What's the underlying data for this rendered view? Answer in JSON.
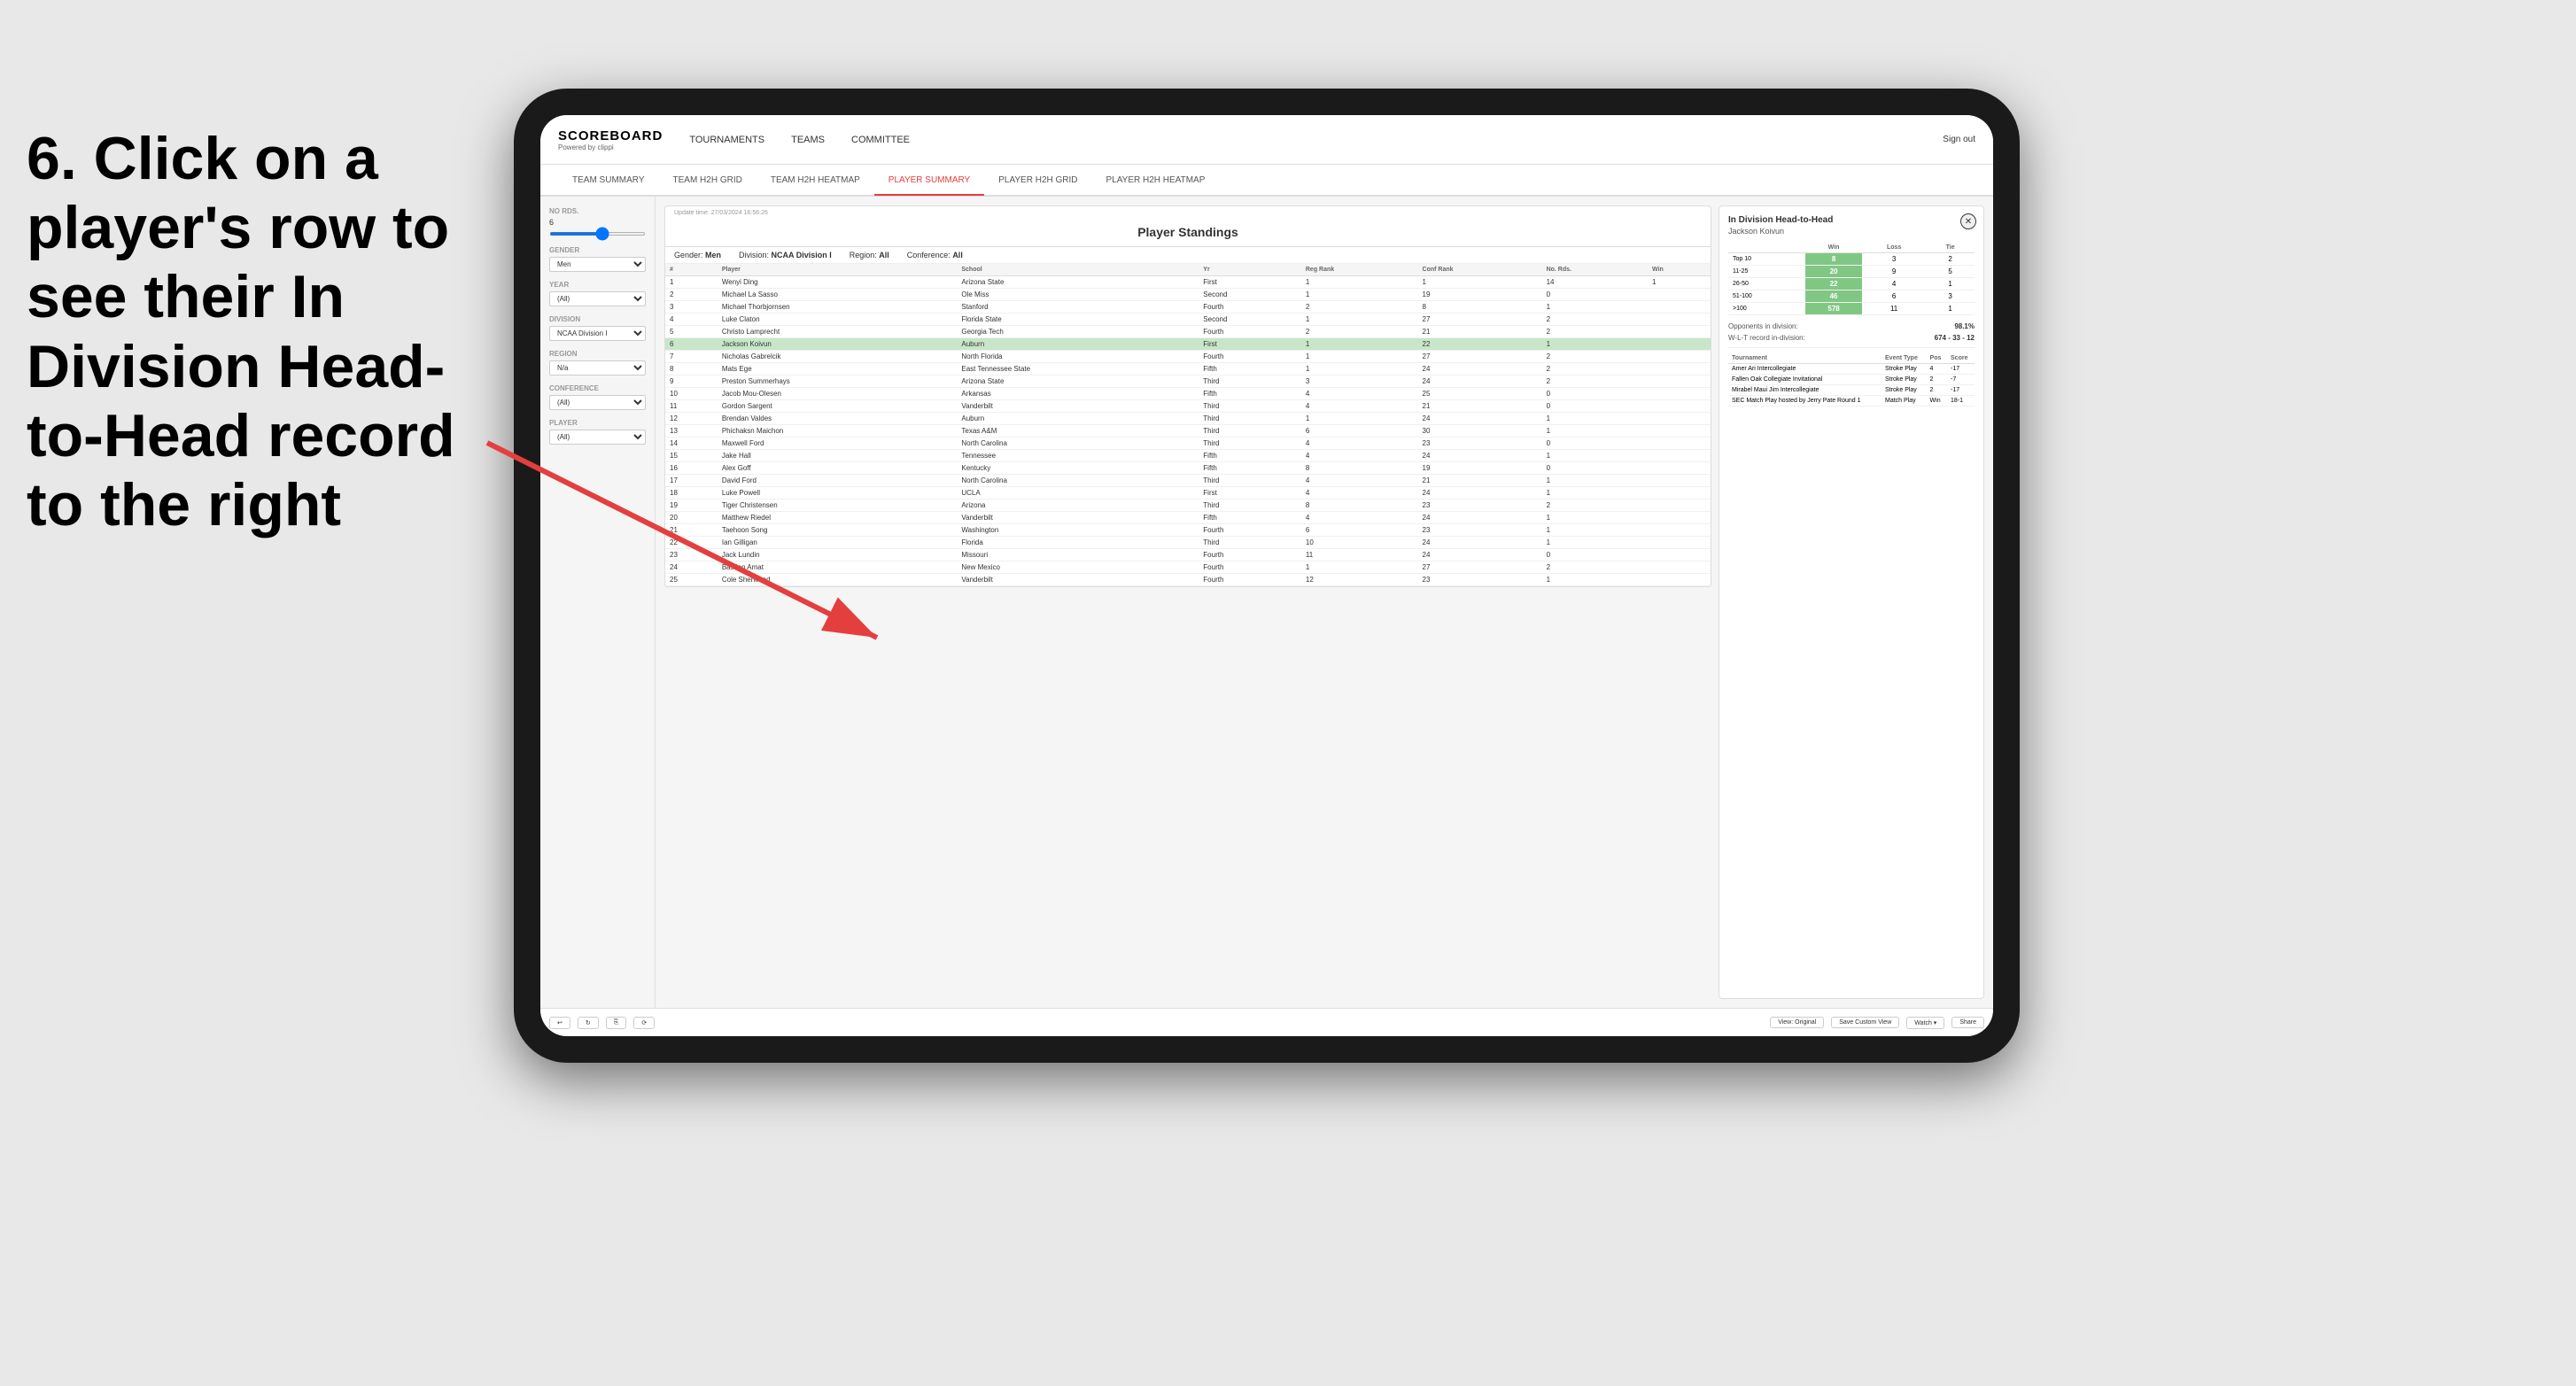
{
  "instruction": {
    "text": "6. Click on a player's row to see their In Division Head-to-Head record to the right"
  },
  "nav": {
    "logo": "SCOREBOARD",
    "logo_sub": "Powered by clippi",
    "links": [
      "TOURNAMENTS",
      "TEAMS",
      "COMMITTEE"
    ],
    "sign_out": "Sign out"
  },
  "sub_nav": {
    "items": [
      "TEAM SUMMARY",
      "TEAM H2H GRID",
      "TEAM H2H HEATMAP",
      "PLAYER SUMMARY",
      "PLAYER H2H GRID",
      "PLAYER H2H HEATMAP"
    ],
    "active": "PLAYER SUMMARY"
  },
  "sidebar": {
    "no_rds_label": "No Rds.",
    "no_rds_value": "6",
    "gender_label": "Gender",
    "gender_value": "Men",
    "year_label": "Year",
    "year_value": "(All)",
    "division_label": "Division",
    "division_value": "NCAA Division I",
    "region_label": "Region",
    "region_value": "N/a",
    "conference_label": "Conference",
    "conference_value": "(All)",
    "player_label": "Player",
    "player_value": "(All)"
  },
  "standings": {
    "title": "Player Standings",
    "update_time": "Update time:",
    "update_date": "27/03/2024 16:56:26",
    "gender": "Men",
    "division": "NCAA Division I",
    "region": "All",
    "conference": "All",
    "columns": [
      "#",
      "Player",
      "School",
      "Yr",
      "Reg Rank",
      "Conf Rank",
      "No. Rds.",
      "Win"
    ],
    "rows": [
      {
        "rank": 1,
        "player": "Wenyi Ding",
        "school": "Arizona State",
        "yr": "First",
        "reg": 1,
        "conf": 1,
        "rds": 14,
        "win": 1
      },
      {
        "rank": 2,
        "player": "Michael La Sasso",
        "school": "Ole Miss",
        "yr": "Second",
        "reg": 1,
        "conf": 19,
        "rds": 0
      },
      {
        "rank": 3,
        "player": "Michael Thorbjornsen",
        "school": "Stanford",
        "yr": "Fourth",
        "reg": 2,
        "conf": 8,
        "rds": 1
      },
      {
        "rank": 4,
        "player": "Luke Claton",
        "school": "Florida State",
        "yr": "Second",
        "reg": 1,
        "conf": 27,
        "rds": 2
      },
      {
        "rank": 5,
        "player": "Christo Lamprecht",
        "school": "Georgia Tech",
        "yr": "Fourth",
        "reg": 2,
        "conf": 21,
        "rds": 2
      },
      {
        "rank": 6,
        "player": "Jackson Koivun",
        "school": "Auburn",
        "yr": "First",
        "reg": 1,
        "conf": 22,
        "rds": 1,
        "highlighted": true
      },
      {
        "rank": 7,
        "player": "Nicholas Gabrelcik",
        "school": "North Florida",
        "yr": "Fourth",
        "reg": 1,
        "conf": 27,
        "rds": 2
      },
      {
        "rank": 8,
        "player": "Mats Ege",
        "school": "East Tennessee State",
        "yr": "Fifth",
        "reg": 1,
        "conf": 24,
        "rds": 2
      },
      {
        "rank": 9,
        "player": "Preston Summerhays",
        "school": "Arizona State",
        "yr": "Third",
        "reg": 3,
        "conf": 24,
        "rds": 2
      },
      {
        "rank": 10,
        "player": "Jacob Mou-Olesen",
        "school": "Arkansas",
        "yr": "Fifth",
        "reg": 4,
        "conf": 25,
        "rds": 0
      },
      {
        "rank": 11,
        "player": "Gordon Sargent",
        "school": "Vanderbilt",
        "yr": "Third",
        "reg": 4,
        "conf": 21,
        "rds": 0
      },
      {
        "rank": 12,
        "player": "Brendan Valdes",
        "school": "Auburn",
        "yr": "Third",
        "reg": 1,
        "conf": 24,
        "rds": 1
      },
      {
        "rank": 13,
        "player": "Phichaksn Maichon",
        "school": "Texas A&M",
        "yr": "Third",
        "reg": 6,
        "conf": 30,
        "rds": 1
      },
      {
        "rank": 14,
        "player": "Maxwell Ford",
        "school": "North Carolina",
        "yr": "Third",
        "reg": 4,
        "conf": 23,
        "rds": 0
      },
      {
        "rank": 15,
        "player": "Jake Hall",
        "school": "Tennessee",
        "yr": "Fifth",
        "reg": 4,
        "conf": 24,
        "rds": 1
      },
      {
        "rank": 16,
        "player": "Alex Goff",
        "school": "Kentucky",
        "yr": "Fifth",
        "reg": 8,
        "conf": 19,
        "rds": 0
      },
      {
        "rank": 17,
        "player": "David Ford",
        "school": "North Carolina",
        "yr": "Third",
        "reg": 4,
        "conf": 21,
        "rds": 1
      },
      {
        "rank": 18,
        "player": "Luke Powell",
        "school": "UCLA",
        "yr": "First",
        "reg": 4,
        "conf": 24,
        "rds": 1
      },
      {
        "rank": 19,
        "player": "Tiger Christensen",
        "school": "Arizona",
        "yr": "Third",
        "reg": 8,
        "conf": 23,
        "rds": 2
      },
      {
        "rank": 20,
        "player": "Matthew Riedel",
        "school": "Vanderbilt",
        "yr": "Fifth",
        "reg": 4,
        "conf": 24,
        "rds": 1
      },
      {
        "rank": 21,
        "player": "Taehoon Song",
        "school": "Washington",
        "yr": "Fourth",
        "reg": 6,
        "conf": 23,
        "rds": 1
      },
      {
        "rank": 22,
        "player": "Ian Gilligan",
        "school": "Florida",
        "yr": "Third",
        "reg": 10,
        "conf": 24,
        "rds": 1
      },
      {
        "rank": 23,
        "player": "Jack Lundin",
        "school": "Missouri",
        "yr": "Fourth",
        "reg": 11,
        "conf": 24,
        "rds": 0
      },
      {
        "rank": 24,
        "player": "Bastien Amat",
        "school": "New Mexico",
        "yr": "Fourth",
        "reg": 1,
        "conf": 27,
        "rds": 2
      },
      {
        "rank": 25,
        "player": "Cole Sherwood",
        "school": "Vanderbilt",
        "yr": "Fourth",
        "reg": 12,
        "conf": 23,
        "rds": 1
      }
    ]
  },
  "h2h": {
    "title": "In Division Head-to-Head",
    "player": "Jackson Koivun",
    "table_headers": [
      "",
      "Win",
      "Loss",
      "Tie"
    ],
    "rows": [
      {
        "range": "Top 10",
        "win": 8,
        "loss": 3,
        "tie": 2,
        "win_highlight": true
      },
      {
        "range": "11-25",
        "win": 20,
        "loss": 9,
        "tie": 5,
        "win_highlight": true
      },
      {
        "range": "26-50",
        "win": 22,
        "loss": 4,
        "tie": 1,
        "win_highlight": true
      },
      {
        "range": "51-100",
        "win": 46,
        "loss": 6,
        "tie": 3,
        "win_highlight": true
      },
      {
        "range": ">100",
        "win": 578,
        "loss": 11,
        "tie": 1,
        "win_highlight": true
      }
    ],
    "opponents_pct": "98.1%",
    "wlt_record": "674 - 33 - 12",
    "opponents_label": "Opponents in division:",
    "wlt_label": "W-L-T record in-division:",
    "tournament_headers": [
      "Tournament",
      "Event Type",
      "Pos",
      "Score"
    ],
    "tournaments": [
      {
        "name": "Amer Ari Intercollegiate",
        "type": "Stroke Play",
        "pos": 4,
        "score": "-17"
      },
      {
        "name": "Fallen Oak Collegiate Invitational",
        "type": "Stroke Play",
        "pos": 2,
        "score": "-7"
      },
      {
        "name": "Mirabel Maui Jim Intercollegiate",
        "type": "Stroke Play",
        "pos": 2,
        "score": "-17"
      },
      {
        "name": "SEC Match Play hosted by Jerry Pate Round 1",
        "type": "Match Play",
        "pos": "Win",
        "score": "18-1"
      }
    ]
  },
  "toolbar": {
    "view_original": "View: Original",
    "save_custom": "Save Custom View",
    "watch": "Watch ▾",
    "share": "Share"
  }
}
